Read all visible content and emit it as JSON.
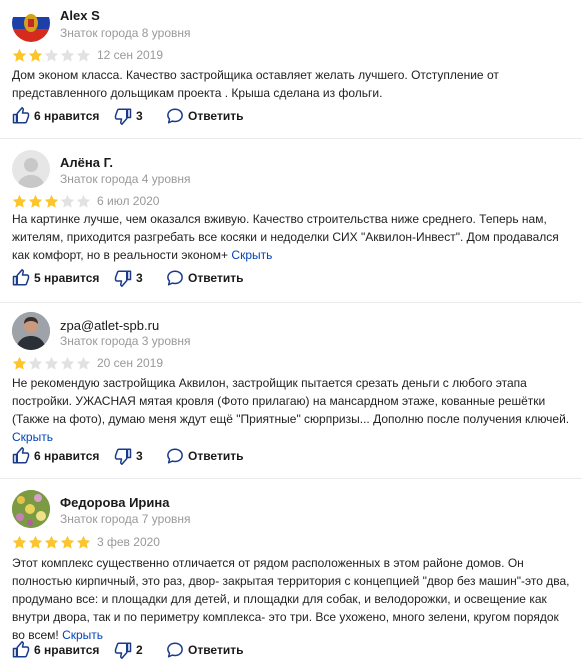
{
  "colors": {
    "star_on": "#fcc52c",
    "star_off": "#e2e2e2",
    "link": "#0044bb"
  },
  "reviews": [
    {
      "author": "Alex S",
      "level": "Знаток города 8 уровня",
      "avatar": "flag-avatar",
      "rating": 2,
      "date": "12 сен 2019",
      "text": "Дом эконом класса. Качество застройщика оставляет желать лучшего. Отступление от представленного дольщикам проекта . Крыша сделана из фольги.",
      "hide_label": "",
      "likes": "6 нравится",
      "dislikes": "3",
      "reply": "Ответить"
    },
    {
      "author": "Алёна Г.",
      "level": "Знаток города 4 уровня",
      "avatar": "default-avatar",
      "rating": 3,
      "date": "6 июл 2020",
      "text": "На картинке лучше, чем оказался вживую. Качество строительства ниже среднего. Теперь нам, жителям, приходится разгребать все косяки и недоделки СИХ \"Аквилон-Инвест\". Дом продавался как комфорт, но в реальности эконом+",
      "hide_label": "Скрыть",
      "likes": "5 нравится",
      "dislikes": "3",
      "reply": "Ответить"
    },
    {
      "author": "zpa@atlet-spb.ru",
      "level": "Знаток города 3 уровня",
      "avatar": "photo-avatar",
      "rating": 1,
      "date": "20 сен 2019",
      "text": "Не рекомендую застройщика Аквилон, застройщик пытается срезать деньги с любого этапа постройки. УЖАСНАЯ мятая кровля (Фото прилагаю) на мансардном этаже, кованные решётки (Также на фото), думаю меня ждут ещё \"Приятные\" сюрпризы... Дополню после получения ключей.",
      "hide_label": "Скрыть",
      "likes": "6 нравится",
      "dislikes": "3",
      "reply": "Ответить"
    },
    {
      "author": "Федорова Ирина",
      "level": "Знаток города 7 уровня",
      "avatar": "flowers-avatar",
      "rating": 5,
      "date": "3 фев 2020",
      "text": "Этот комплекс существенно отличается от рядом расположенных в этом районе домов. Он полностью кирпичный, это раз, двор- закрытая территория с концепцией \"двор без машин\"-это два, продумано все: и площадки для детей, и площадки для собак, и велодорожки, и освещение как внутри двора, так и по периметру комплекса- это три. Все ухожено, много зелени, кругом порядок во всем!",
      "hide_label": "Скрыть",
      "likes": "6 нравится",
      "dislikes": "2",
      "reply": "Ответить"
    }
  ]
}
